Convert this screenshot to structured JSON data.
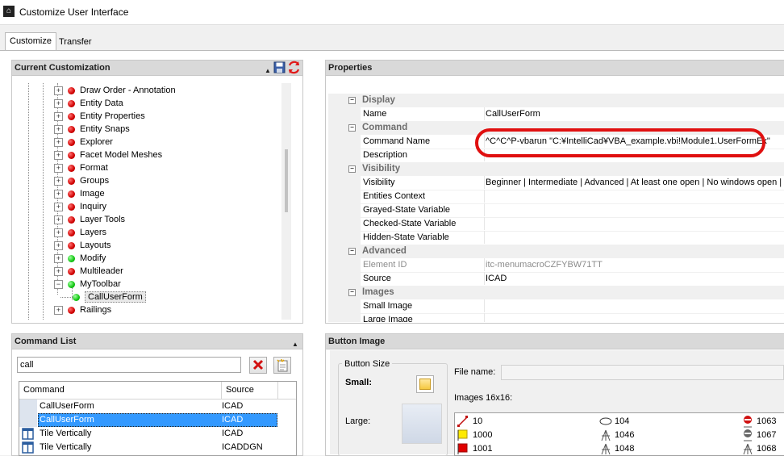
{
  "window": {
    "title": "Customize User Interface"
  },
  "tabs": [
    {
      "label": "Customize"
    },
    {
      "label": "Transfer"
    }
  ],
  "current_customization": {
    "title": "Current Customization",
    "items": [
      {
        "label": "Draw Order - Annotation",
        "status": "red"
      },
      {
        "label": "Entity Data",
        "status": "red"
      },
      {
        "label": "Entity Properties",
        "status": "red"
      },
      {
        "label": "Entity Snaps",
        "status": "red"
      },
      {
        "label": "Explorer",
        "status": "red"
      },
      {
        "label": "Facet Model Meshes",
        "status": "red"
      },
      {
        "label": "Format",
        "status": "red"
      },
      {
        "label": "Groups",
        "status": "red"
      },
      {
        "label": "Image",
        "status": "red"
      },
      {
        "label": "Inquiry",
        "status": "red"
      },
      {
        "label": "Layer Tools",
        "status": "red"
      },
      {
        "label": "Layers",
        "status": "red"
      },
      {
        "label": "Layouts",
        "status": "red"
      },
      {
        "label": "Modify",
        "status": "green"
      },
      {
        "label": "Multileader",
        "status": "red"
      },
      {
        "label": "MyToolbar",
        "status": "green"
      },
      {
        "label": "CallUserForm",
        "status": "green"
      },
      {
        "label": "Railings",
        "status": "red"
      }
    ]
  },
  "command_list": {
    "title": "Command List",
    "search_value": "call",
    "columns": {
      "command": "Command",
      "source": "Source"
    },
    "rows": [
      {
        "command": "CallUserForm",
        "source": "ICAD"
      },
      {
        "command": "CallUserForm",
        "source": "ICAD"
      },
      {
        "command": "Tile Vertically",
        "source": "ICAD"
      },
      {
        "command": "Tile Vertically",
        "source": "ICADDGN"
      }
    ]
  },
  "properties": {
    "title": "Properties",
    "rows": [
      {
        "type": "category",
        "label": "Display"
      },
      {
        "type": "prop",
        "name": "Name",
        "value": "CallUserForm"
      },
      {
        "type": "category",
        "label": "Command"
      },
      {
        "type": "prop",
        "name": "Command Name",
        "value": "^C^C^P-vbarun \"C:¥IntelliCad¥VBA_example.vbi!Module1.UserFormEx\""
      },
      {
        "type": "prop",
        "name": "Description",
        "value": ""
      },
      {
        "type": "category",
        "label": "Visibility"
      },
      {
        "type": "prop",
        "name": "Visibility",
        "value": "Beginner | Intermediate | Advanced | At least one open | No windows open | Co"
      },
      {
        "type": "prop",
        "name": "Entities Context",
        "value": ""
      },
      {
        "type": "prop",
        "name": "Grayed-State Variable",
        "value": ""
      },
      {
        "type": "prop",
        "name": "Checked-State Variable",
        "value": ""
      },
      {
        "type": "prop",
        "name": "Hidden-State Variable",
        "value": ""
      },
      {
        "type": "category",
        "label": "Advanced"
      },
      {
        "type": "prop",
        "name": "Element ID",
        "value": "itc-menumacroCZFYBW71TT",
        "grey": true
      },
      {
        "type": "prop",
        "name": "Source",
        "value": "ICAD"
      },
      {
        "type": "category",
        "label": "Images"
      },
      {
        "type": "prop",
        "name": "Small Image",
        "value": ""
      },
      {
        "type": "prop",
        "name": "Large Image",
        "value": ""
      }
    ]
  },
  "button_image": {
    "title": "Button Image",
    "button_size_label": "Button Size",
    "small_label": "Small:",
    "large_label": "Large:",
    "file_name_label": "File name:",
    "file_name_value": "",
    "images_label": "Images 16x16:",
    "images": [
      {
        "label": "10",
        "icon": "draw-line-icon"
      },
      {
        "label": "1000",
        "icon": "yellow-flag-icon"
      },
      {
        "label": "1001",
        "icon": "red-flag-icon"
      },
      {
        "label": "104",
        "icon": "ellipse-icon"
      },
      {
        "label": "1046",
        "icon": "survey-icon"
      },
      {
        "label": "1048",
        "icon": "survey-icon"
      },
      {
        "label": "1063",
        "icon": "red-marker-icon"
      },
      {
        "label": "1067",
        "icon": "grey-marker-icon"
      },
      {
        "label": "1068",
        "icon": "survey-icon"
      }
    ]
  }
}
